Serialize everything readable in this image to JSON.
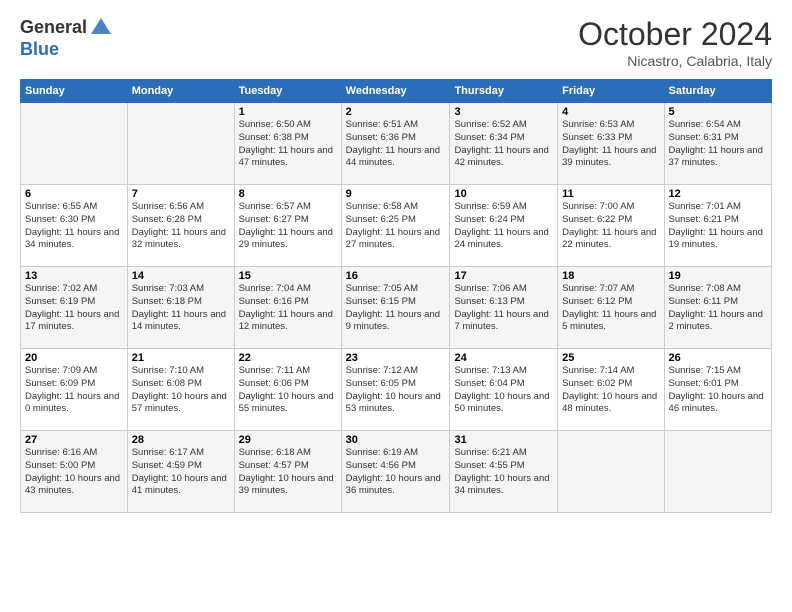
{
  "logo": {
    "general": "General",
    "blue": "Blue"
  },
  "title": "October 2024",
  "location": "Nicastro, Calabria, Italy",
  "days_header": [
    "Sunday",
    "Monday",
    "Tuesday",
    "Wednesday",
    "Thursday",
    "Friday",
    "Saturday"
  ],
  "weeks": [
    [
      {
        "num": "",
        "sunrise": "",
        "sunset": "",
        "daylight": ""
      },
      {
        "num": "",
        "sunrise": "",
        "sunset": "",
        "daylight": ""
      },
      {
        "num": "1",
        "sunrise": "Sunrise: 6:50 AM",
        "sunset": "Sunset: 6:38 PM",
        "daylight": "Daylight: 11 hours and 47 minutes."
      },
      {
        "num": "2",
        "sunrise": "Sunrise: 6:51 AM",
        "sunset": "Sunset: 6:36 PM",
        "daylight": "Daylight: 11 hours and 44 minutes."
      },
      {
        "num": "3",
        "sunrise": "Sunrise: 6:52 AM",
        "sunset": "Sunset: 6:34 PM",
        "daylight": "Daylight: 11 hours and 42 minutes."
      },
      {
        "num": "4",
        "sunrise": "Sunrise: 6:53 AM",
        "sunset": "Sunset: 6:33 PM",
        "daylight": "Daylight: 11 hours and 39 minutes."
      },
      {
        "num": "5",
        "sunrise": "Sunrise: 6:54 AM",
        "sunset": "Sunset: 6:31 PM",
        "daylight": "Daylight: 11 hours and 37 minutes."
      }
    ],
    [
      {
        "num": "6",
        "sunrise": "Sunrise: 6:55 AM",
        "sunset": "Sunset: 6:30 PM",
        "daylight": "Daylight: 11 hours and 34 minutes."
      },
      {
        "num": "7",
        "sunrise": "Sunrise: 6:56 AM",
        "sunset": "Sunset: 6:28 PM",
        "daylight": "Daylight: 11 hours and 32 minutes."
      },
      {
        "num": "8",
        "sunrise": "Sunrise: 6:57 AM",
        "sunset": "Sunset: 6:27 PM",
        "daylight": "Daylight: 11 hours and 29 minutes."
      },
      {
        "num": "9",
        "sunrise": "Sunrise: 6:58 AM",
        "sunset": "Sunset: 6:25 PM",
        "daylight": "Daylight: 11 hours and 27 minutes."
      },
      {
        "num": "10",
        "sunrise": "Sunrise: 6:59 AM",
        "sunset": "Sunset: 6:24 PM",
        "daylight": "Daylight: 11 hours and 24 minutes."
      },
      {
        "num": "11",
        "sunrise": "Sunrise: 7:00 AM",
        "sunset": "Sunset: 6:22 PM",
        "daylight": "Daylight: 11 hours and 22 minutes."
      },
      {
        "num": "12",
        "sunrise": "Sunrise: 7:01 AM",
        "sunset": "Sunset: 6:21 PM",
        "daylight": "Daylight: 11 hours and 19 minutes."
      }
    ],
    [
      {
        "num": "13",
        "sunrise": "Sunrise: 7:02 AM",
        "sunset": "Sunset: 6:19 PM",
        "daylight": "Daylight: 11 hours and 17 minutes."
      },
      {
        "num": "14",
        "sunrise": "Sunrise: 7:03 AM",
        "sunset": "Sunset: 6:18 PM",
        "daylight": "Daylight: 11 hours and 14 minutes."
      },
      {
        "num": "15",
        "sunrise": "Sunrise: 7:04 AM",
        "sunset": "Sunset: 6:16 PM",
        "daylight": "Daylight: 11 hours and 12 minutes."
      },
      {
        "num": "16",
        "sunrise": "Sunrise: 7:05 AM",
        "sunset": "Sunset: 6:15 PM",
        "daylight": "Daylight: 11 hours and 9 minutes."
      },
      {
        "num": "17",
        "sunrise": "Sunrise: 7:06 AM",
        "sunset": "Sunset: 6:13 PM",
        "daylight": "Daylight: 11 hours and 7 minutes."
      },
      {
        "num": "18",
        "sunrise": "Sunrise: 7:07 AM",
        "sunset": "Sunset: 6:12 PM",
        "daylight": "Daylight: 11 hours and 5 minutes."
      },
      {
        "num": "19",
        "sunrise": "Sunrise: 7:08 AM",
        "sunset": "Sunset: 6:11 PM",
        "daylight": "Daylight: 11 hours and 2 minutes."
      }
    ],
    [
      {
        "num": "20",
        "sunrise": "Sunrise: 7:09 AM",
        "sunset": "Sunset: 6:09 PM",
        "daylight": "Daylight: 11 hours and 0 minutes."
      },
      {
        "num": "21",
        "sunrise": "Sunrise: 7:10 AM",
        "sunset": "Sunset: 6:08 PM",
        "daylight": "Daylight: 10 hours and 57 minutes."
      },
      {
        "num": "22",
        "sunrise": "Sunrise: 7:11 AM",
        "sunset": "Sunset: 6:06 PM",
        "daylight": "Daylight: 10 hours and 55 minutes."
      },
      {
        "num": "23",
        "sunrise": "Sunrise: 7:12 AM",
        "sunset": "Sunset: 6:05 PM",
        "daylight": "Daylight: 10 hours and 53 minutes."
      },
      {
        "num": "24",
        "sunrise": "Sunrise: 7:13 AM",
        "sunset": "Sunset: 6:04 PM",
        "daylight": "Daylight: 10 hours and 50 minutes."
      },
      {
        "num": "25",
        "sunrise": "Sunrise: 7:14 AM",
        "sunset": "Sunset: 6:02 PM",
        "daylight": "Daylight: 10 hours and 48 minutes."
      },
      {
        "num": "26",
        "sunrise": "Sunrise: 7:15 AM",
        "sunset": "Sunset: 6:01 PM",
        "daylight": "Daylight: 10 hours and 46 minutes."
      }
    ],
    [
      {
        "num": "27",
        "sunrise": "Sunrise: 6:16 AM",
        "sunset": "Sunset: 5:00 PM",
        "daylight": "Daylight: 10 hours and 43 minutes."
      },
      {
        "num": "28",
        "sunrise": "Sunrise: 6:17 AM",
        "sunset": "Sunset: 4:59 PM",
        "daylight": "Daylight: 10 hours and 41 minutes."
      },
      {
        "num": "29",
        "sunrise": "Sunrise: 6:18 AM",
        "sunset": "Sunset: 4:57 PM",
        "daylight": "Daylight: 10 hours and 39 minutes."
      },
      {
        "num": "30",
        "sunrise": "Sunrise: 6:19 AM",
        "sunset": "Sunset: 4:56 PM",
        "daylight": "Daylight: 10 hours and 36 minutes."
      },
      {
        "num": "31",
        "sunrise": "Sunrise: 6:21 AM",
        "sunset": "Sunset: 4:55 PM",
        "daylight": "Daylight: 10 hours and 34 minutes."
      },
      {
        "num": "",
        "sunrise": "",
        "sunset": "",
        "daylight": ""
      },
      {
        "num": "",
        "sunrise": "",
        "sunset": "",
        "daylight": ""
      }
    ]
  ]
}
